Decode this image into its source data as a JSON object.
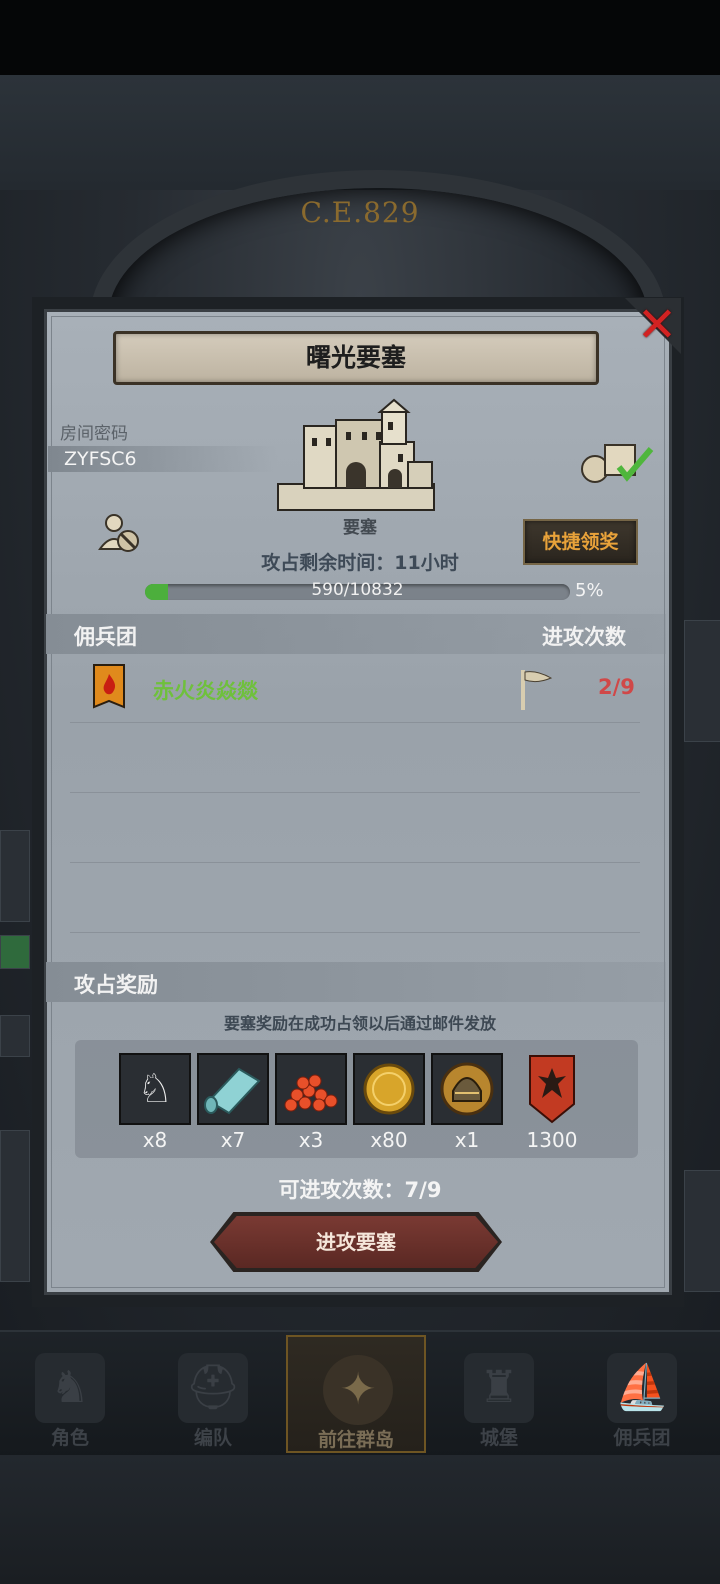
{
  "header": {
    "era_text": "C.E.829"
  },
  "dialog": {
    "title": "曙光要塞",
    "room_code_label": "房间密码",
    "room_code": "ZYFSC6",
    "building_label": "要塞",
    "time_remaining": "攻占剩余时间：11小时",
    "progress": {
      "text": "590/10832",
      "percent_label": "5%",
      "fraction": 0.0545
    },
    "quick_claim_label": "快捷领奖",
    "guild_section": {
      "left": "佣兵团",
      "right": "进攻次数"
    },
    "guild_rows": [
      {
        "name": "赤火炎焱燚",
        "count": "2/9"
      }
    ],
    "reward_section": {
      "title": "攻占奖励",
      "note": "要塞奖励在成功占领以后通过邮件发放"
    },
    "rewards": [
      {
        "icon": "horse-icon",
        "qty": "x8"
      },
      {
        "icon": "cloth-icon",
        "qty": "x7"
      },
      {
        "icon": "roe-icon",
        "qty": "x3"
      },
      {
        "icon": "gold-coin-icon",
        "qty": "x80"
      },
      {
        "icon": "helmet-icon",
        "qty": "x1"
      },
      {
        "icon": "banner-icon",
        "qty": "1300"
      }
    ],
    "remaining_attacks": "可进攻次数：7/9",
    "attack_button": "进攻要塞"
  },
  "nav": [
    {
      "label": "角色"
    },
    {
      "label": "编队"
    },
    {
      "label": "前往群岛"
    },
    {
      "label": "城堡"
    },
    {
      "label": "佣兵团"
    }
  ],
  "colors": {
    "progress": "#4caf3c",
    "guild_name": "#6fc03c",
    "count": "#d04848",
    "quick_btn_text": "#e8a23a",
    "close": "#d22222"
  }
}
